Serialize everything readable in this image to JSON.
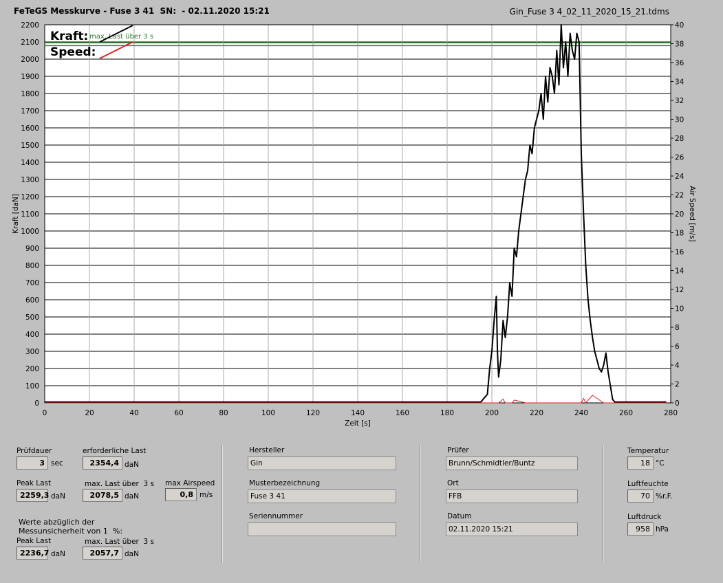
{
  "header": {
    "title": "FeTeGS Messkurve - Fuse 3 41  SN:  - 02.11.2020 15:21",
    "file": "Gin_Fuse 3 4_02_11_2020_15_21.tdms"
  },
  "chart_data": {
    "type": "line",
    "xlabel": "Zeit [s]",
    "ylabel": "Kraft [daN]",
    "y2label": "Air Speed [m/s]",
    "xlim": [
      0,
      280
    ],
    "ylim": [
      0,
      2200
    ],
    "y2lim": [
      0,
      40
    ],
    "x_ticks": [
      "0",
      "20",
      "40",
      "60",
      "80",
      "100",
      "120",
      "140",
      "160",
      "180",
      "200",
      "220",
      "240",
      "260",
      "280"
    ],
    "y_ticks": [
      "0",
      "100",
      "200",
      "300",
      "400",
      "500",
      "600",
      "700",
      "800",
      "900",
      "1000",
      "1100",
      "1200",
      "1300",
      "1400",
      "1500",
      "1600",
      "1700",
      "1800",
      "1900",
      "2000",
      "2100",
      "2200"
    ],
    "y2_ticks": [
      "0",
      "2",
      "4",
      "6",
      "8",
      "10",
      "12",
      "14",
      "16",
      "18",
      "20",
      "22",
      "24",
      "26",
      "28",
      "30",
      "32",
      "34",
      "36",
      "38",
      "40"
    ],
    "grid": true,
    "legend": [
      {
        "label": "Kraft:",
        "color": "#000000"
      },
      {
        "label": "Speed:",
        "color": "#e02020"
      }
    ],
    "annotation": "max. Last über  3 s",
    "annotation_value": 2078.5,
    "annotation_color": "#2e7d2e",
    "series": [
      {
        "name": "Kraft",
        "color": "#000000",
        "axis": "left",
        "x": [
          0,
          195,
          198,
          199,
          200,
          201,
          202,
          202.5,
          203,
          204,
          205,
          206,
          207,
          208,
          209,
          210,
          211,
          212,
          213,
          214,
          215,
          216,
          217,
          218,
          219,
          220,
          221,
          222,
          223,
          224,
          225,
          226,
          227,
          228,
          229,
          230,
          231,
          232,
          233,
          234,
          235,
          236,
          237,
          238,
          239,
          240,
          241,
          242,
          243,
          244,
          245,
          246,
          247,
          248,
          249,
          250,
          251,
          252,
          253,
          254,
          255,
          256,
          256.5,
          257,
          258,
          260,
          265,
          278
        ],
        "y": [
          5,
          5,
          50,
          200,
          300,
          480,
          620,
          300,
          150,
          250,
          480,
          380,
          500,
          700,
          620,
          900,
          850,
          1000,
          1100,
          1200,
          1300,
          1350,
          1500,
          1450,
          1600,
          1650,
          1700,
          1800,
          1650,
          1900,
          1750,
          1950,
          1900,
          1800,
          2050,
          1850,
          2200,
          1950,
          2100,
          1900,
          2150,
          2050,
          2000,
          2150,
          2100,
          1450,
          1100,
          800,
          600,
          480,
          380,
          300,
          250,
          200,
          180,
          220,
          290,
          180,
          100,
          20,
          5,
          5,
          5,
          5,
          5,
          5,
          5,
          5
        ]
      },
      {
        "name": "Speed",
        "color": "#e02020",
        "axis": "right",
        "x": [
          0,
          198,
          203,
          205,
          206,
          209,
          210,
          215,
          240,
          241,
          242,
          245,
          250,
          278
        ],
        "y": [
          0,
          0,
          0,
          0.4,
          0,
          0,
          0.3,
          0,
          0,
          0.5,
          0,
          0.8,
          0,
          0
        ]
      }
    ]
  },
  "panel": {
    "pruefdauer": {
      "label": "Prüfdauer",
      "value": "3",
      "unit": "sec"
    },
    "erforderliche_last": {
      "label": "erforderliche Last",
      "value": "2354,4",
      "unit": "daN"
    },
    "peak_last": {
      "label": "Peak Last",
      "value": "2259,3",
      "unit": "daN"
    },
    "max_last": {
      "label": "max. Last über  3 s",
      "value": "2078,5",
      "unit": "daN"
    },
    "max_airspeed": {
      "label": "max Airspeed",
      "value": "0,8",
      "unit": "m/s"
    },
    "werte_note": "Werte abzüglich der\nMessunsicherheit von 1  %:",
    "peak_last2": {
      "label": "Peak Last",
      "value": "2236,7",
      "unit": "daN"
    },
    "max_last2": {
      "label": "max. Last über  3 s",
      "value": "2057,7",
      "unit": "daN"
    },
    "hersteller": {
      "label": "Hersteller",
      "value": "Gin"
    },
    "musterbezeichnung": {
      "label": "Musterbezeichnung",
      "value": "Fuse 3 41"
    },
    "seriennummer": {
      "label": "Seriennummer",
      "value": ""
    },
    "pruefer": {
      "label": "Prüfer",
      "value": "Brunn/Schmidtler/Buntz"
    },
    "ort": {
      "label": "Ort",
      "value": "FFB"
    },
    "datum": {
      "label": "Datum",
      "value": "02.11.2020 15:21"
    },
    "temperatur": {
      "label": "Temperatur",
      "value": "18",
      "unit": "°C"
    },
    "luftfeuchte": {
      "label": "Luftfeuchte",
      "value": "70",
      "unit": "%r.F."
    },
    "luftdruck": {
      "label": "Luftdruck",
      "value": "958",
      "unit": "hPa"
    }
  }
}
